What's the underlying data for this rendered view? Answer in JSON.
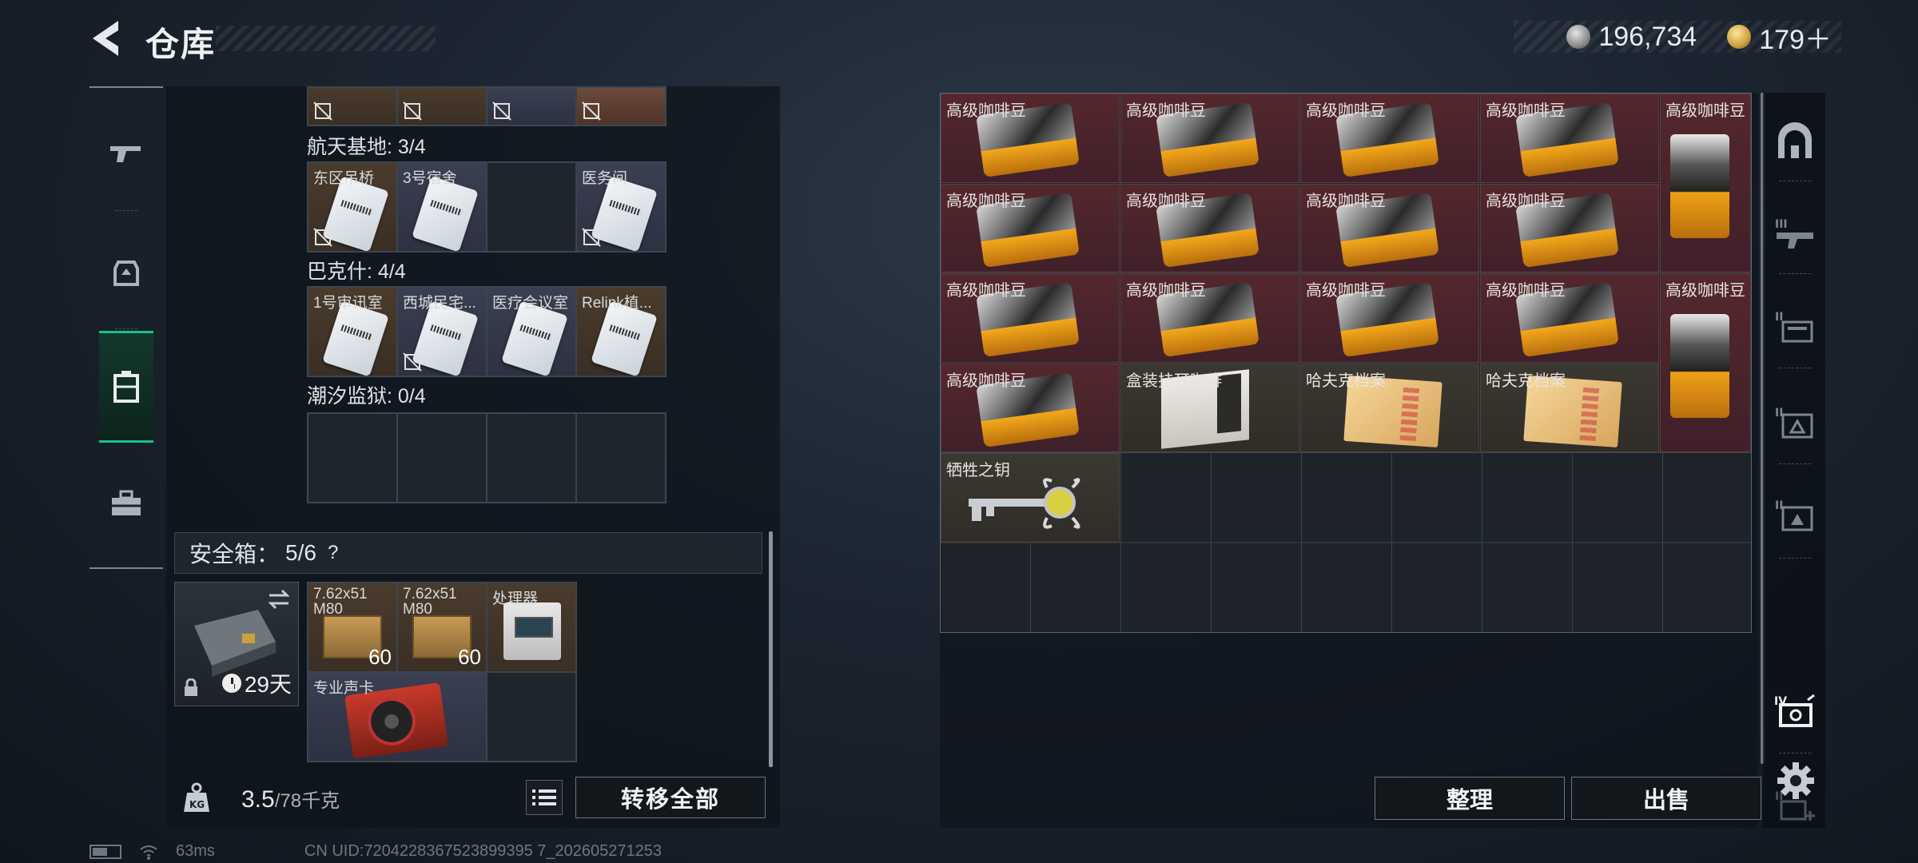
{
  "header": {
    "title": "仓库",
    "back_label": "back",
    "silver_amount": "196,734",
    "gold_amount": "179＋"
  },
  "left_tabs": [
    {
      "name": "weapons"
    },
    {
      "name": "gear"
    },
    {
      "name": "container"
    },
    {
      "name": "toolbox"
    }
  ],
  "keycards": {
    "top_row": {
      "items": [
        {
          "label": ""
        },
        {
          "label": ""
        },
        {
          "label": ""
        },
        {
          "label": ""
        }
      ]
    },
    "sections": [
      {
        "label": "航天基地: 3/4",
        "items": [
          {
            "label": "东区吊桥",
            "filled": true,
            "unlocked": false
          },
          {
            "label": "3号宿舍",
            "filled": true,
            "unlocked": true
          },
          {
            "label": "",
            "filled": false
          },
          {
            "label": "医务间",
            "filled": true,
            "unlocked": false
          }
        ]
      },
      {
        "label": "巴克什: 4/4",
        "items": [
          {
            "label": "1号审讯室",
            "filled": true,
            "unlocked": true
          },
          {
            "label": "西城民宅...",
            "filled": true,
            "unlocked": false
          },
          {
            "label": "医疗会议室",
            "filled": true,
            "unlocked": true
          },
          {
            "label": "Relink植...",
            "filled": true,
            "unlocked": true
          }
        ]
      },
      {
        "label": "潮汐监狱: 0/4",
        "items": [
          {
            "label": ""
          },
          {
            "label": ""
          },
          {
            "label": ""
          },
          {
            "label": ""
          }
        ]
      }
    ]
  },
  "safebox": {
    "title": "安全箱：",
    "count": "5/6",
    "help": "?",
    "days": "29天",
    "items": [
      {
        "label": "7.62x51 M80",
        "count": "60"
      },
      {
        "label": "7.62x51 M80",
        "count": "60"
      },
      {
        "label": "处理器",
        "count": ""
      },
      {
        "label": "专业声卡",
        "count": ""
      }
    ]
  },
  "weight": {
    "current": "3.5",
    "max": "/78千克"
  },
  "transfer_all_label": "转移全部",
  "stash": {
    "items": [
      {
        "label": "高级咖啡豆"
      },
      {
        "label": "高级咖啡豆"
      },
      {
        "label": "高级咖啡豆"
      },
      {
        "label": "高级咖啡豆"
      },
      {
        "label": "高级咖啡豆"
      },
      {
        "label": "高级咖啡豆"
      },
      {
        "label": "高级咖啡豆"
      },
      {
        "label": "高级咖啡豆"
      },
      {
        "label": "高级咖啡豆"
      },
      {
        "label": "高级咖啡豆"
      },
      {
        "label": "高级咖啡豆"
      },
      {
        "label": "高级咖啡豆"
      },
      {
        "label": "高级咖啡豆"
      },
      {
        "label": "高级咖啡豆"
      },
      {
        "label": "高级咖啡豆"
      },
      {
        "label": "盒装挂耳咖啡"
      },
      {
        "label": "哈夫克档案"
      },
      {
        "label": "哈夫克档案"
      },
      {
        "label": "牺牲之钥"
      }
    ]
  },
  "right_tabs": [
    {
      "name": "home"
    },
    {
      "name": "tier-3-gun"
    },
    {
      "name": "tier-2"
    },
    {
      "name": "tier-3"
    },
    {
      "name": "tier-2b"
    },
    {
      "name": "tier-4"
    },
    {
      "name": "add"
    }
  ],
  "sort_label": "整理",
  "sell_label": "出售",
  "status": {
    "ping": "63ms",
    "uid": "CN UID:7204228367523899395 7_202605271253"
  }
}
